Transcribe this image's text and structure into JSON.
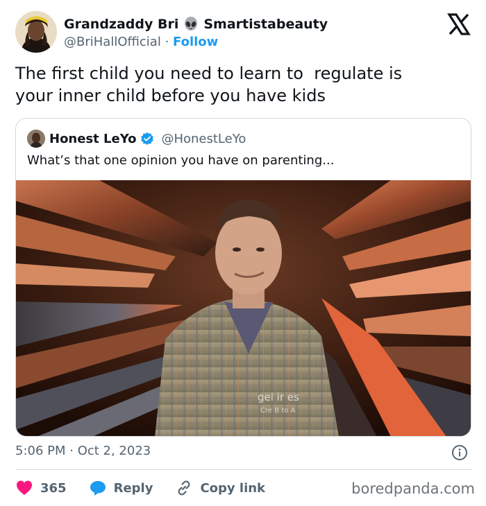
{
  "author": {
    "display_name": "Grandzaddy Bri",
    "display_name_suffix": "Smartistabeauty",
    "handle": "@BriHallOfficial",
    "separator": "·",
    "follow_label": "Follow",
    "name_emoji": "alien-icon"
  },
  "tweet": {
    "text": "The first child you need to learn to  regulate is\nyour inner child before you have kids"
  },
  "quoted_tweet": {
    "display_name": "Honest LeYo",
    "handle": "@HonestLeYo",
    "verified": true,
    "text": "What’s that one opinion you have on parenting...",
    "image_watermark_line1": "gel    ir    es",
    "image_watermark_line2": "Cre    B    to A"
  },
  "meta": {
    "timestamp": "5:06 PM · Oct 2, 2023"
  },
  "actions": {
    "likes": "365",
    "reply_label": "Reply",
    "copy_link_label": "Copy link"
  },
  "watermark": "boredpanda.com",
  "colors": {
    "accent": "#1d9bf0",
    "heart": "#f91880",
    "text": "#0f1419",
    "muted": "#536471",
    "border": "#cfd9de"
  }
}
